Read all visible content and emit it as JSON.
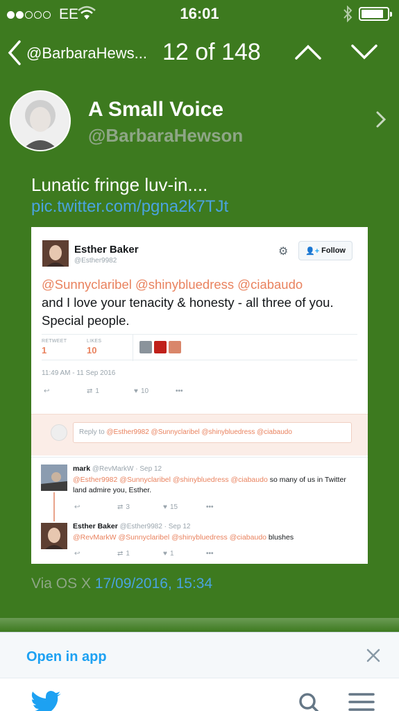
{
  "status": {
    "carrier": "EE",
    "time": "16:01"
  },
  "nav": {
    "back_label": "@BarbaraHews...",
    "counter": "12 of 148"
  },
  "profile": {
    "name": "A Small Voice",
    "handle": "@BarbaraHewson"
  },
  "tweet": {
    "text": "Lunatic fringe luv-in....",
    "link": "pic.twitter.com/pgna2k7TJt",
    "via": "Via OS X",
    "timestamp": "17/09/2016, 15:34"
  },
  "embed": {
    "author_name": "Esther Baker",
    "author_handle": "@Esther9982",
    "follow_label": "Follow",
    "body_mentions": "@Sunnyclaribel @shinybluedress  @ciabaudo",
    "body_text": "and I love your tenacity & honesty - all three of you. Special people.",
    "retweet_label": "RETWEET",
    "retweet_count": "1",
    "likes_label": "LIKES",
    "likes_count": "10",
    "date": "11:49 AM - 11 Sep 2016",
    "action_retweets": "1",
    "action_likes": "10",
    "reply_placeholder_prefix": "Reply to ",
    "reply_placeholder_mentions": "@Esther9982 @Sunnyclaribel @shinybluedress @ciabaudo",
    "replies": [
      {
        "name": "mark",
        "meta": "@RevMarkW · Sep 12",
        "mentions": "@Esther9982 @Sunnyclaribel @shinybluedress @ciabaudo",
        "text": " so many of us in Twitter land admire you, Esther.",
        "retweets": "3",
        "likes": "15"
      },
      {
        "name": "Esther Baker",
        "meta": "@Esther9982 · Sep 12",
        "mentions": "@RevMarkW @Sunnyclaribel @shinybluedress @ciabaudo",
        "text": " blushes",
        "retweets": "1",
        "likes": "1"
      }
    ]
  },
  "banner": {
    "open_in_app": "Open in app"
  },
  "colors": {
    "background": "#3d7a1f",
    "link": "#4aa3df",
    "mention": "#e9825e",
    "twitter_blue": "#1da1f2"
  },
  "icons": [
    "wifi-icon",
    "bluetooth-icon",
    "battery-icon",
    "back-chevron-icon",
    "arrow-up-icon",
    "arrow-down-icon",
    "chevron-right-icon",
    "gear-icon",
    "reply-icon",
    "retweet-icon",
    "heart-icon",
    "more-icon",
    "close-icon",
    "twitter-bird-icon",
    "search-icon",
    "menu-icon"
  ]
}
